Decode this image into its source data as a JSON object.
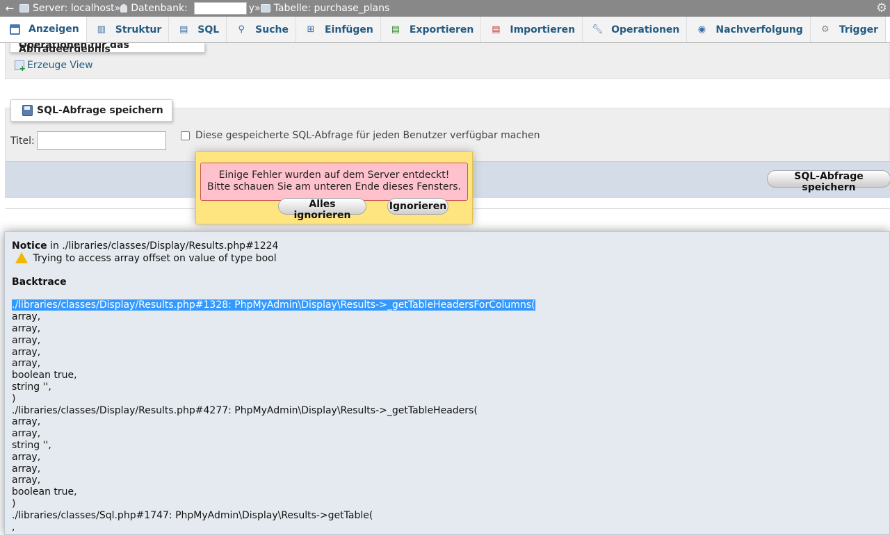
{
  "breadcrumb": {
    "back": "←",
    "server": "Server: localhost",
    "database_label": "Datenbank:",
    "database_suffix": "y",
    "table": "Tabelle: purchase_plans",
    "separator": "»"
  },
  "tabs": [
    {
      "label": "Anzeigen",
      "icon": "browse-icon",
      "active": true
    },
    {
      "label": "Struktur",
      "icon": "structure-icon"
    },
    {
      "label": "SQL",
      "icon": "sql-icon"
    },
    {
      "label": "Suche",
      "icon": "search-icon"
    },
    {
      "label": "Einfügen",
      "icon": "insert-icon"
    },
    {
      "label": "Exportieren",
      "icon": "export-icon"
    },
    {
      "label": "Importieren",
      "icon": "import-icon"
    },
    {
      "label": "Operationen",
      "icon": "wrench-icon"
    },
    {
      "label": "Nachverfolgung",
      "icon": "eye-icon"
    },
    {
      "label": "Trigger",
      "icon": "trigger-icon"
    }
  ],
  "ops": {
    "legend": "Operationen für das Abfrageergebnis",
    "create_view": "Erzeuge View"
  },
  "save_sql": {
    "legend": "SQL-Abfrage speichern",
    "title_label": "Titel:",
    "title_value": "",
    "checkbox_label": "Diese gespeicherte SQL-Abfrage für jeden Benutzer verfügbar machen",
    "button": "SQL-Abfrage speichern"
  },
  "error_modal": {
    "line1": "Einige Fehler wurden auf dem Server entdeckt!",
    "line2": "Bitte schauen Sie am unteren Ende dieses Fensters.",
    "ignore_all": "Alles ignorieren",
    "ignore": "Ignorieren"
  },
  "notice": {
    "label": "Notice",
    "location": " in ./libraries/classes/Display/Results.php#1224",
    "message": "Trying to access array offset on value of type bool",
    "backtrace_title": "Backtrace",
    "trace_highlighted": "./libraries/classes/Display/Results.php#1328: PhpMyAdmin\\Display\\Results->_getTableHeadersForColumns(",
    "trace_lines": [
      "array,",
      "array,",
      "array,",
      "array,",
      "array,",
      "boolean true,",
      "string '',",
      ")",
      "./libraries/classes/Display/Results.php#4277: PhpMyAdmin\\Display\\Results->_getTableHeaders(",
      "array,",
      "array,",
      "string '',",
      "array,",
      "array,",
      "array,",
      "boolean true,",
      ")",
      "./libraries/classes/Sql.php#1747: PhpMyAdmin\\Display\\Results->getTable(",
      ","
    ]
  }
}
